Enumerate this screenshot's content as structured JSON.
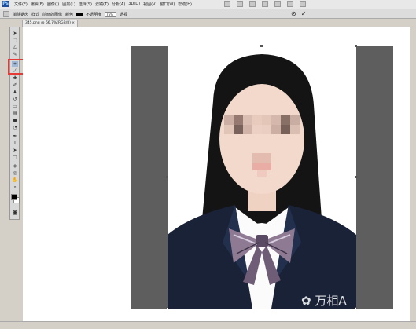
{
  "app": {
    "logo": "Ps"
  },
  "menu": [
    "文件(F)",
    "编辑(E)",
    "图像(I)",
    "图层(L)",
    "选择(S)",
    "滤镜(T)",
    "分析(A)",
    "3D(D)",
    "视图(V)",
    "窗口(W)",
    "帮助(H)"
  ],
  "options": {
    "antialias_label": "消除锯齿",
    "style_label": "样式",
    "front_label": "前面的图像",
    "color_label": "颜色",
    "opacity_label": "不透明度",
    "opacity_value": "75%",
    "perspective_label": "透视",
    "cancel_symbol": "⊘",
    "commit_symbol": "✓"
  },
  "document": {
    "tab_title": "345.png @ 66.7%(RGB/8) ×"
  },
  "watermark": {
    "text": "万相A"
  },
  "colors": {
    "highlight": "#e53935",
    "canvas_bg": "#5e5e5e",
    "blazer": "#1a2238"
  }
}
